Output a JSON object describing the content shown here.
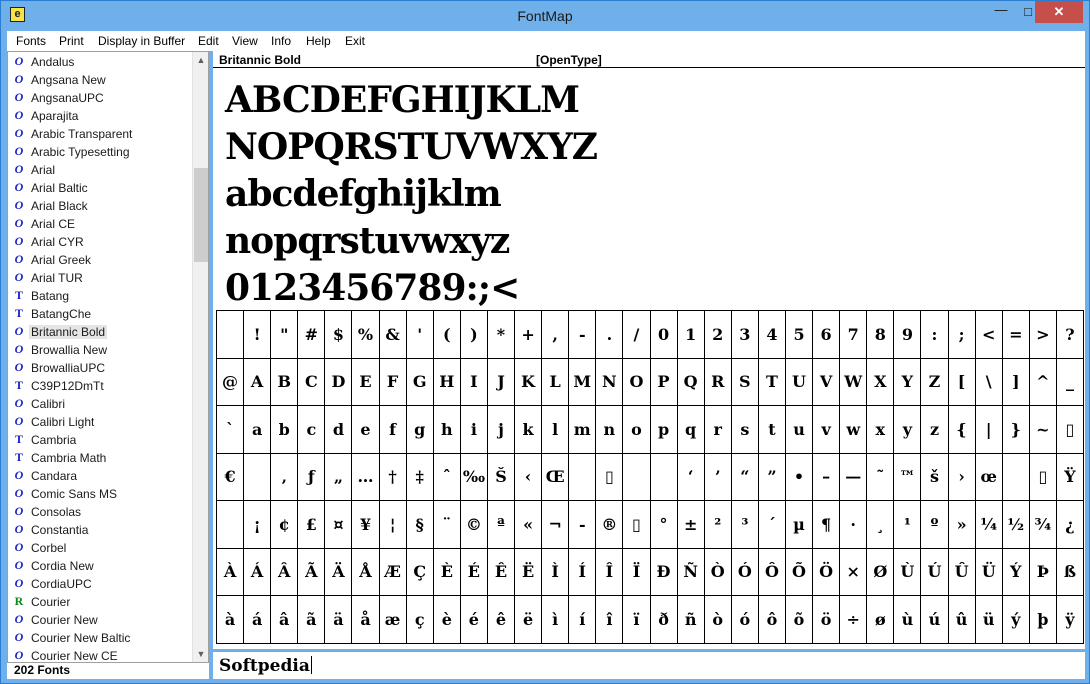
{
  "window": {
    "title": "FontMap",
    "icon_letter": "e",
    "minimize": "—",
    "maximize": "□",
    "close": "✕"
  },
  "menu": [
    "Fonts",
    "Print",
    "Display in Buffer",
    "Edit",
    "View",
    "Info",
    "Help",
    "Exit"
  ],
  "font_list": [
    {
      "icon": "O",
      "type": "opentype",
      "name": "Andalus"
    },
    {
      "icon": "O",
      "type": "opentype",
      "name": "Angsana New"
    },
    {
      "icon": "O",
      "type": "opentype",
      "name": "AngsanaUPC"
    },
    {
      "icon": "O",
      "type": "opentype",
      "name": "Aparajita"
    },
    {
      "icon": "O",
      "type": "opentype",
      "name": "Arabic Transparent"
    },
    {
      "icon": "O",
      "type": "opentype",
      "name": "Arabic Typesetting"
    },
    {
      "icon": "O",
      "type": "opentype",
      "name": "Arial"
    },
    {
      "icon": "O",
      "type": "opentype",
      "name": "Arial Baltic"
    },
    {
      "icon": "O",
      "type": "opentype",
      "name": "Arial Black"
    },
    {
      "icon": "O",
      "type": "opentype",
      "name": "Arial CE"
    },
    {
      "icon": "O",
      "type": "opentype",
      "name": "Arial CYR"
    },
    {
      "icon": "O",
      "type": "opentype",
      "name": "Arial Greek"
    },
    {
      "icon": "O",
      "type": "opentype",
      "name": "Arial TUR"
    },
    {
      "icon": "T",
      "type": "truetype",
      "name": "Batang"
    },
    {
      "icon": "T",
      "type": "truetype",
      "name": "BatangChe"
    },
    {
      "icon": "O",
      "type": "opentype",
      "name": "Britannic Bold",
      "selected": true
    },
    {
      "icon": "O",
      "type": "opentype",
      "name": "Browallia New"
    },
    {
      "icon": "O",
      "type": "opentype",
      "name": "BrowalliaUPC"
    },
    {
      "icon": "T",
      "type": "truetype",
      "name": "C39P12DmTt"
    },
    {
      "icon": "O",
      "type": "opentype",
      "name": "Calibri"
    },
    {
      "icon": "O",
      "type": "opentype",
      "name": "Calibri Light"
    },
    {
      "icon": "T",
      "type": "truetype",
      "name": "Cambria"
    },
    {
      "icon": "T",
      "type": "truetype",
      "name": "Cambria Math"
    },
    {
      "icon": "O",
      "type": "opentype",
      "name": "Candara"
    },
    {
      "icon": "O",
      "type": "opentype",
      "name": "Comic Sans MS"
    },
    {
      "icon": "O",
      "type": "opentype",
      "name": "Consolas"
    },
    {
      "icon": "O",
      "type": "opentype",
      "name": "Constantia"
    },
    {
      "icon": "O",
      "type": "opentype",
      "name": "Corbel"
    },
    {
      "icon": "O",
      "type": "opentype",
      "name": "Cordia New"
    },
    {
      "icon": "O",
      "type": "opentype",
      "name": "CordiaUPC"
    },
    {
      "icon": "R",
      "type": "raster",
      "name": "Courier"
    },
    {
      "icon": "O",
      "type": "opentype",
      "name": "Courier New"
    },
    {
      "icon": "O",
      "type": "opentype",
      "name": "Courier New Baltic"
    },
    {
      "icon": "O",
      "type": "opentype",
      "name": "Courier New CE"
    }
  ],
  "status": {
    "font_count": "202 Fonts"
  },
  "preview": {
    "font_name": "Britannic Bold",
    "font_type": "[OpenType]",
    "samples": [
      "ABCDEFGHIJKLM",
      "NOPQRSTUVWXYZ",
      "abcdefghijklm",
      "nopqrstuvwxyz",
      "0123456789:;<"
    ]
  },
  "glyph_rows": [
    [
      " ",
      "!",
      "\"",
      "#",
      "$",
      "%",
      "&",
      "'",
      "(",
      ")",
      "*",
      "+",
      ",",
      "-",
      ".",
      "/",
      "0",
      "1",
      "2",
      "3",
      "4",
      "5",
      "6",
      "7",
      "8",
      "9",
      ":",
      ";",
      "<",
      "=",
      ">",
      "?"
    ],
    [
      "@",
      "A",
      "B",
      "C",
      "D",
      "E",
      "F",
      "G",
      "H",
      "I",
      "J",
      "K",
      "L",
      "M",
      "N",
      "O",
      "P",
      "Q",
      "R",
      "S",
      "T",
      "U",
      "V",
      "W",
      "X",
      "Y",
      "Z",
      "[",
      "\\",
      "]",
      "^",
      "_"
    ],
    [
      "`",
      "a",
      "b",
      "c",
      "d",
      "e",
      "f",
      "g",
      "h",
      "i",
      "j",
      "k",
      "l",
      "m",
      "n",
      "o",
      "p",
      "q",
      "r",
      "s",
      "t",
      "u",
      "v",
      "w",
      "x",
      "y",
      "z",
      "{",
      "|",
      "}",
      "~",
      "▯"
    ],
    [
      "€",
      " ",
      "‚",
      "ƒ",
      "„",
      "…",
      "†",
      "‡",
      "ˆ",
      "‰",
      "Š",
      "‹",
      "Œ",
      " ",
      "▯",
      " ",
      " ",
      "‘",
      "’",
      "“",
      "”",
      "•",
      "–",
      "—",
      "˜",
      "™",
      "š",
      "›",
      "œ",
      " ",
      "▯",
      "Ÿ"
    ],
    [
      " ",
      "¡",
      "¢",
      "£",
      "¤",
      "¥",
      "¦",
      "§",
      "¨",
      "©",
      "ª",
      "«",
      "¬",
      "-",
      "®",
      "▯",
      "°",
      "±",
      "²",
      "³",
      "´",
      "µ",
      "¶",
      "·",
      "¸",
      "¹",
      "º",
      "»",
      "¼",
      "½",
      "¾",
      "¿"
    ],
    [
      "À",
      "Á",
      "Â",
      "Ã",
      "Ä",
      "Å",
      "Æ",
      "Ç",
      "È",
      "É",
      "Ê",
      "Ë",
      "Ì",
      "Í",
      "Î",
      "Ï",
      "Ð",
      "Ñ",
      "Ò",
      "Ó",
      "Ô",
      "Õ",
      "Ö",
      "×",
      "Ø",
      "Ù",
      "Ú",
      "Û",
      "Ü",
      "Ý",
      "Þ",
      "ß"
    ],
    [
      "à",
      "á",
      "â",
      "ã",
      "ä",
      "å",
      "æ",
      "ç",
      "è",
      "é",
      "ê",
      "ë",
      "ì",
      "í",
      "î",
      "ï",
      "ð",
      "ñ",
      "ò",
      "ó",
      "ô",
      "õ",
      "ö",
      "÷",
      "ø",
      "ù",
      "ú",
      "û",
      "ü",
      "ý",
      "þ",
      "ÿ"
    ]
  ],
  "input": {
    "text": "Softpedia"
  }
}
